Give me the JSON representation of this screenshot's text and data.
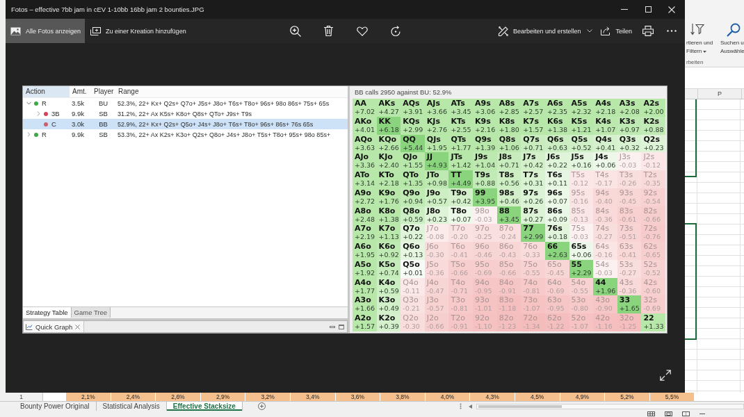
{
  "window": {
    "title": "Fotos – effective 7bb jam in cEV 1-10bb 16bb jam 2 bounties.JPG"
  },
  "toolbar": {
    "left": [
      {
        "label": "Alle Fotos anzeigen",
        "selected": true
      },
      {
        "label": "Zu einer Kreation hinzufügen",
        "selected": false
      }
    ],
    "right": [
      {
        "label": "Bearbeiten und erstellen",
        "kind": "menu"
      },
      {
        "label": "Teilen",
        "kind": "button"
      }
    ]
  },
  "image": {
    "strategy_table": {
      "columns": [
        {
          "label": "Action",
          "selected": true
        },
        {
          "label": "Amt.",
          "selected": false
        },
        {
          "label": "Player",
          "selected": false
        },
        {
          "label": "Range",
          "selected": false
        }
      ],
      "rows": [
        {
          "action": "R",
          "amount": "3.5k",
          "player": "BU",
          "range": "52.3%, 22+ Kx+ Q2s+ Q7o+ J5s+ J8o+ T6s+ T8o+ 96s+ 98o 86s+ 75s+ 65s",
          "color": "#3fa94a",
          "has_children": true,
          "expanded": true,
          "selected": false,
          "children": [
            {
              "action": "3B",
              "amount": "9.9k",
              "player": "SB",
              "range": "31.2%, 22+ Ax K5s+ K8o+ Q8s+ QTo+ J9s+ T9s",
              "color": "#d2455a",
              "has_children": true,
              "expanded": false,
              "selected": false
            },
            {
              "action": "C",
              "amount": "3.0k",
              "player": "BB",
              "range": "52.9%, 22+ Kx+ Q2s+ Q5o+ J4s+ J8o+ T6s+ T8o+ 96s+ 86s+ 76s 65s",
              "color": "#c9606f",
              "has_children": false,
              "selected": true
            }
          ]
        },
        {
          "action": "R",
          "amount": "9.9k",
          "player": "SB",
          "range": "53.3%, 22+ Ax K2s+ K3o+ Q2s+ Q8o+ J4s+ J8o+ T5s+ T8o+ 95s+ 98o 85s+",
          "color": "#3fa94a",
          "has_children": true,
          "expanded": false,
          "selected": false
        }
      ]
    },
    "view_tabs": [
      {
        "label": "Strategy Table",
        "selected": true
      },
      {
        "label": "Game Tree",
        "selected": false
      }
    ],
    "quick_graph": {
      "title": "Quick Graph"
    },
    "matrix": {
      "title": "BB calls 2950 against BU: 52.9%",
      "rows": [
        {
          "cells": [
            {
              "hand": "AA",
              "ev": "+7.02",
              "in_range": true,
              "highlighted": false
            },
            {
              "hand": "AKs",
              "ev": "+4.27",
              "in_range": true,
              "highlighted": false
            },
            {
              "hand": "AQs",
              "ev": "+3.91",
              "in_range": true,
              "highlighted": false
            },
            {
              "hand": "AJs",
              "ev": "+3.66",
              "in_range": true,
              "highlighted": false
            },
            {
              "hand": "ATs",
              "ev": "+3.45",
              "in_range": true,
              "highlighted": false
            },
            {
              "hand": "A9s",
              "ev": "+3.06",
              "in_range": true,
              "highlighted": false
            },
            {
              "hand": "A8s",
              "ev": "+2.85",
              "in_range": true,
              "highlighted": false
            },
            {
              "hand": "A7s",
              "ev": "+2.57",
              "in_range": true,
              "highlighted": false
            },
            {
              "hand": "A6s",
              "ev": "+2.35",
              "in_range": true,
              "highlighted": false
            },
            {
              "hand": "A5s",
              "ev": "+2.32",
              "in_range": true,
              "highlighted": false
            },
            {
              "hand": "A4s",
              "ev": "+2.18",
              "in_range": true,
              "highlighted": false
            },
            {
              "hand": "A3s",
              "ev": "+2.08",
              "in_range": true,
              "highlighted": false
            },
            {
              "hand": "A2s",
              "ev": "+2.00",
              "in_range": true,
              "highlighted": false
            }
          ]
        },
        {
          "cells": [
            {
              "hand": "AKo",
              "ev": "+4.01",
              "in_range": true,
              "highlighted": false
            },
            {
              "hand": "KK",
              "ev": "+6.18",
              "in_range": true,
              "highlighted": true
            },
            {
              "hand": "KQs",
              "ev": "+2.99",
              "in_range": true,
              "highlighted": false
            },
            {
              "hand": "KJs",
              "ev": "+2.76",
              "in_range": true,
              "highlighted": false
            },
            {
              "hand": "KTs",
              "ev": "+2.55",
              "in_range": true,
              "highlighted": false
            },
            {
              "hand": "K9s",
              "ev": "+2.16",
              "in_range": true,
              "highlighted": false
            },
            {
              "hand": "K8s",
              "ev": "+1.80",
              "in_range": true,
              "highlighted": false
            },
            {
              "hand": "K7s",
              "ev": "+1.57",
              "in_range": true,
              "highlighted": false
            },
            {
              "hand": "K6s",
              "ev": "+1.38",
              "in_range": true,
              "highlighted": false
            },
            {
              "hand": "K5s",
              "ev": "+1.21",
              "in_range": true,
              "highlighted": false
            },
            {
              "hand": "K4s",
              "ev": "+1.07",
              "in_range": true,
              "highlighted": false
            },
            {
              "hand": "K3s",
              "ev": "+0.97",
              "in_range": true,
              "highlighted": false
            },
            {
              "hand": "K2s",
              "ev": "+0.88",
              "in_range": true,
              "highlighted": false
            }
          ]
        },
        {
          "cells": [
            {
              "hand": "AQo",
              "ev": "+3.63",
              "in_range": true,
              "highlighted": false
            },
            {
              "hand": "KQo",
              "ev": "+2.66",
              "in_range": true,
              "highlighted": false
            },
            {
              "hand": "QQ",
              "ev": "+5.44",
              "in_range": true,
              "highlighted": true
            },
            {
              "hand": "QJs",
              "ev": "+1.95",
              "in_range": true,
              "highlighted": false
            },
            {
              "hand": "QTs",
              "ev": "+1.77",
              "in_range": true,
              "highlighted": false
            },
            {
              "hand": "Q9s",
              "ev": "+1.39",
              "in_range": true,
              "highlighted": false
            },
            {
              "hand": "Q8s",
              "ev": "+1.06",
              "in_range": true,
              "highlighted": false
            },
            {
              "hand": "Q7s",
              "ev": "+0.71",
              "in_range": true,
              "highlighted": false
            },
            {
              "hand": "Q6s",
              "ev": "+0.63",
              "in_range": true,
              "highlighted": false
            },
            {
              "hand": "Q5s",
              "ev": "+0.52",
              "in_range": true,
              "highlighted": false
            },
            {
              "hand": "Q4s",
              "ev": "+0.41",
              "in_range": true,
              "highlighted": false
            },
            {
              "hand": "Q3s",
              "ev": "+0.32",
              "in_range": true,
              "highlighted": false
            },
            {
              "hand": "Q2s",
              "ev": "+0.23",
              "in_range": true,
              "highlighted": false
            }
          ]
        },
        {
          "cells": [
            {
              "hand": "AJo",
              "ev": "+3.36",
              "in_range": true,
              "highlighted": false
            },
            {
              "hand": "KJo",
              "ev": "+2.40",
              "in_range": true,
              "highlighted": false
            },
            {
              "hand": "QJo",
              "ev": "+1.55",
              "in_range": true,
              "highlighted": false
            },
            {
              "hand": "JJ",
              "ev": "+4.93",
              "in_range": true,
              "highlighted": true
            },
            {
              "hand": "JTs",
              "ev": "+1.42",
              "in_range": true,
              "highlighted": false
            },
            {
              "hand": "J9s",
              "ev": "+1.04",
              "in_range": true,
              "highlighted": false
            },
            {
              "hand": "J8s",
              "ev": "+0.71",
              "in_range": true,
              "highlighted": false
            },
            {
              "hand": "J7s",
              "ev": "+0.42",
              "in_range": true,
              "highlighted": false
            },
            {
              "hand": "J6s",
              "ev": "+0.22",
              "in_range": true,
              "highlighted": false
            },
            {
              "hand": "J5s",
              "ev": "+0.16",
              "in_range": true,
              "highlighted": false
            },
            {
              "hand": "J4s",
              "ev": "+0.06",
              "in_range": true,
              "highlighted": false
            },
            {
              "hand": "J3s",
              "ev": "-0.03",
              "in_range": false,
              "highlighted": false
            },
            {
              "hand": "J2s",
              "ev": "-0.12",
              "in_range": false,
              "highlighted": false
            }
          ]
        },
        {
          "cells": [
            {
              "hand": "ATo",
              "ev": "+3.14",
              "in_range": true,
              "highlighted": false
            },
            {
              "hand": "KTo",
              "ev": "+2.18",
              "in_range": true,
              "highlighted": false
            },
            {
              "hand": "QTo",
              "ev": "+1.35",
              "in_range": true,
              "highlighted": false
            },
            {
              "hand": "JTo",
              "ev": "+0.98",
              "in_range": true,
              "highlighted": false
            },
            {
              "hand": "TT",
              "ev": "+4.49",
              "in_range": true,
              "highlighted": true
            },
            {
              "hand": "T9s",
              "ev": "+0.88",
              "in_range": true,
              "highlighted": false
            },
            {
              "hand": "T8s",
              "ev": "+0.56",
              "in_range": true,
              "highlighted": false
            },
            {
              "hand": "T7s",
              "ev": "+0.31",
              "in_range": true,
              "highlighted": false
            },
            {
              "hand": "T6s",
              "ev": "+0.11",
              "in_range": true,
              "highlighted": false
            },
            {
              "hand": "T5s",
              "ev": "-0.12",
              "in_range": false,
              "highlighted": false
            },
            {
              "hand": "T4s",
              "ev": "-0.17",
              "in_range": false,
              "highlighted": false
            },
            {
              "hand": "T3s",
              "ev": "-0.26",
              "in_range": false,
              "highlighted": false
            },
            {
              "hand": "T2s",
              "ev": "-0.35",
              "in_range": false,
              "highlighted": false
            }
          ]
        },
        {
          "cells": [
            {
              "hand": "A9o",
              "ev": "+2.72",
              "in_range": true,
              "highlighted": false
            },
            {
              "hand": "K9o",
              "ev": "+1.76",
              "in_range": true,
              "highlighted": false
            },
            {
              "hand": "Q9o",
              "ev": "+0.94",
              "in_range": true,
              "highlighted": false
            },
            {
              "hand": "J9o",
              "ev": "+0.57",
              "in_range": true,
              "highlighted": false
            },
            {
              "hand": "T9o",
              "ev": "+0.42",
              "in_range": true,
              "highlighted": false
            },
            {
              "hand": "99",
              "ev": "+3.95",
              "in_range": true,
              "highlighted": true
            },
            {
              "hand": "98s",
              "ev": "+0.46",
              "in_range": true,
              "highlighted": false
            },
            {
              "hand": "97s",
              "ev": "+0.26",
              "in_range": true,
              "highlighted": false
            },
            {
              "hand": "96s",
              "ev": "+0.07",
              "in_range": true,
              "highlighted": false
            },
            {
              "hand": "95s",
              "ev": "-0.16",
              "in_range": false,
              "highlighted": false
            },
            {
              "hand": "94s",
              "ev": "-0.40",
              "in_range": false,
              "highlighted": false
            },
            {
              "hand": "93s",
              "ev": "-0.45",
              "in_range": false,
              "highlighted": false
            },
            {
              "hand": "92s",
              "ev": "-0.54",
              "in_range": false,
              "highlighted": false
            }
          ]
        },
        {
          "cells": [
            {
              "hand": "A8o",
              "ev": "+2.48",
              "in_range": true,
              "highlighted": false
            },
            {
              "hand": "K8o",
              "ev": "+1.38",
              "in_range": true,
              "highlighted": false
            },
            {
              "hand": "Q8o",
              "ev": "+0.59",
              "in_range": true,
              "highlighted": false
            },
            {
              "hand": "J8o",
              "ev": "+0.23",
              "in_range": true,
              "highlighted": false
            },
            {
              "hand": "T8o",
              "ev": "+0.07",
              "in_range": true,
              "highlighted": false
            },
            {
              "hand": "98o",
              "ev": "-0.03",
              "in_range": false,
              "highlighted": false
            },
            {
              "hand": "88",
              "ev": "+3.45",
              "in_range": true,
              "highlighted": true
            },
            {
              "hand": "87s",
              "ev": "+0.27",
              "in_range": true,
              "highlighted": false
            },
            {
              "hand": "86s",
              "ev": "+0.09",
              "in_range": true,
              "highlighted": false
            },
            {
              "hand": "85s",
              "ev": "-0.13",
              "in_range": false,
              "highlighted": false
            },
            {
              "hand": "84s",
              "ev": "-0.36",
              "in_range": false,
              "highlighted": false
            },
            {
              "hand": "83s",
              "ev": "-0.61",
              "in_range": false,
              "highlighted": false
            },
            {
              "hand": "82s",
              "ev": "-0.66",
              "in_range": false,
              "highlighted": false
            }
          ]
        },
        {
          "cells": [
            {
              "hand": "A7o",
              "ev": "+2.19",
              "in_range": true,
              "highlighted": false
            },
            {
              "hand": "K7o",
              "ev": "+1.13",
              "in_range": true,
              "highlighted": false
            },
            {
              "hand": "Q7o",
              "ev": "+0.22",
              "in_range": true,
              "highlighted": false
            },
            {
              "hand": "J7o",
              "ev": "-0.08",
              "in_range": false,
              "highlighted": false
            },
            {
              "hand": "T7o",
              "ev": "-0.20",
              "in_range": false,
              "highlighted": false
            },
            {
              "hand": "97o",
              "ev": "-0.25",
              "in_range": false,
              "highlighted": false
            },
            {
              "hand": "87o",
              "ev": "-0.24",
              "in_range": false,
              "highlighted": false
            },
            {
              "hand": "77",
              "ev": "+2.99",
              "in_range": true,
              "highlighted": true
            },
            {
              "hand": "76s",
              "ev": "+0.18",
              "in_range": true,
              "highlighted": false
            },
            {
              "hand": "75s",
              "ev": "-0.03",
              "in_range": false,
              "highlighted": false
            },
            {
              "hand": "74s",
              "ev": "-0.27",
              "in_range": false,
              "highlighted": false
            },
            {
              "hand": "73s",
              "ev": "-0.51",
              "in_range": false,
              "highlighted": false
            },
            {
              "hand": "72s",
              "ev": "-0.76",
              "in_range": false,
              "highlighted": false
            }
          ]
        },
        {
          "cells": [
            {
              "hand": "A6o",
              "ev": "+1.95",
              "in_range": true,
              "highlighted": false
            },
            {
              "hand": "K6o",
              "ev": "+0.92",
              "in_range": true,
              "highlighted": false
            },
            {
              "hand": "Q6o",
              "ev": "+0.13",
              "in_range": true,
              "highlighted": false
            },
            {
              "hand": "J6o",
              "ev": "-0.30",
              "in_range": false,
              "highlighted": false
            },
            {
              "hand": "T6o",
              "ev": "-0.41",
              "in_range": false,
              "highlighted": false
            },
            {
              "hand": "96o",
              "ev": "-0.46",
              "in_range": false,
              "highlighted": false
            },
            {
              "hand": "86o",
              "ev": "-0.43",
              "in_range": false,
              "highlighted": false
            },
            {
              "hand": "76o",
              "ev": "-0.33",
              "in_range": false,
              "highlighted": false
            },
            {
              "hand": "66",
              "ev": "+2.63",
              "in_range": true,
              "highlighted": true
            },
            {
              "hand": "65s",
              "ev": "+0.06",
              "in_range": true,
              "highlighted": false
            },
            {
              "hand": "64s",
              "ev": "-0.16",
              "in_range": false,
              "highlighted": false
            },
            {
              "hand": "63s",
              "ev": "-0.41",
              "in_range": false,
              "highlighted": false
            },
            {
              "hand": "62s",
              "ev": "-0.65",
              "in_range": false,
              "highlighted": false
            }
          ]
        },
        {
          "cells": [
            {
              "hand": "A5o",
              "ev": "+1.92",
              "in_range": true,
              "highlighted": false
            },
            {
              "hand": "K5o",
              "ev": "+0.74",
              "in_range": true,
              "highlighted": false
            },
            {
              "hand": "Q5o",
              "ev": "+0.01",
              "in_range": true,
              "highlighted": false
            },
            {
              "hand": "J5o",
              "ev": "-0.36",
              "in_range": false,
              "highlighted": false
            },
            {
              "hand": "T5o",
              "ev": "-0.66",
              "in_range": false,
              "highlighted": false
            },
            {
              "hand": "95o",
              "ev": "-0.69",
              "in_range": false,
              "highlighted": false
            },
            {
              "hand": "85o",
              "ev": "-0.66",
              "in_range": false,
              "highlighted": false
            },
            {
              "hand": "75o",
              "ev": "-0.55",
              "in_range": false,
              "highlighted": false
            },
            {
              "hand": "65o",
              "ev": "-0.45",
              "in_range": false,
              "highlighted": false
            },
            {
              "hand": "55",
              "ev": "+2.29",
              "in_range": true,
              "highlighted": true
            },
            {
              "hand": "54s",
              "ev": "-0.03",
              "in_range": false,
              "highlighted": false
            },
            {
              "hand": "53s",
              "ev": "-0.27",
              "in_range": false,
              "highlighted": false
            },
            {
              "hand": "52s",
              "ev": "-0.52",
              "in_range": false,
              "highlighted": false
            }
          ]
        },
        {
          "cells": [
            {
              "hand": "A4o",
              "ev": "+1.77",
              "in_range": true,
              "highlighted": false
            },
            {
              "hand": "K4o",
              "ev": "+0.59",
              "in_range": true,
              "highlighted": false
            },
            {
              "hand": "Q4o",
              "ev": "-0.11",
              "in_range": false,
              "highlighted": false
            },
            {
              "hand": "J4o",
              "ev": "-0.47",
              "in_range": false,
              "highlighted": false
            },
            {
              "hand": "T4o",
              "ev": "-0.71",
              "in_range": false,
              "highlighted": false
            },
            {
              "hand": "94o",
              "ev": "-0.95",
              "in_range": false,
              "highlighted": false
            },
            {
              "hand": "84o",
              "ev": "-0.91",
              "in_range": false,
              "highlighted": false
            },
            {
              "hand": "74o",
              "ev": "-0.81",
              "in_range": false,
              "highlighted": false
            },
            {
              "hand": "64o",
              "ev": "-0.69",
              "in_range": false,
              "highlighted": false
            },
            {
              "hand": "54o",
              "ev": "-0.55",
              "in_range": false,
              "highlighted": false
            },
            {
              "hand": "44",
              "ev": "+1.96",
              "in_range": true,
              "highlighted": true
            },
            {
              "hand": "43s",
              "ev": "-0.36",
              "in_range": false,
              "highlighted": false
            },
            {
              "hand": "42s",
              "ev": "-0.60",
              "in_range": false,
              "highlighted": false
            }
          ]
        },
        {
          "cells": [
            {
              "hand": "A3o",
              "ev": "+1.66",
              "in_range": true,
              "highlighted": false
            },
            {
              "hand": "K3o",
              "ev": "+0.49",
              "in_range": true,
              "highlighted": false
            },
            {
              "hand": "Q3o",
              "ev": "-0.21",
              "in_range": false,
              "highlighted": false
            },
            {
              "hand": "J3o",
              "ev": "-0.57",
              "in_range": false,
              "highlighted": false
            },
            {
              "hand": "T3o",
              "ev": "-0.81",
              "in_range": false,
              "highlighted": false
            },
            {
              "hand": "93o",
              "ev": "-1.01",
              "in_range": false,
              "highlighted": false
            },
            {
              "hand": "83o",
              "ev": "-1.18",
              "in_range": false,
              "highlighted": false
            },
            {
              "hand": "73o",
              "ev": "-1.07",
              "in_range": false,
              "highlighted": false
            },
            {
              "hand": "63o",
              "ev": "-0.95",
              "in_range": false,
              "highlighted": false
            },
            {
              "hand": "53o",
              "ev": "-0.80",
              "in_range": false,
              "highlighted": false
            },
            {
              "hand": "43o",
              "ev": "-0.90",
              "in_range": false,
              "highlighted": false
            },
            {
              "hand": "33",
              "ev": "+1.65",
              "in_range": true,
              "highlighted": true
            },
            {
              "hand": "32s",
              "ev": "-0.69",
              "in_range": false,
              "highlighted": false
            }
          ]
        },
        {
          "cells": [
            {
              "hand": "A2o",
              "ev": "+1.57",
              "in_range": true,
              "highlighted": false
            },
            {
              "hand": "K2o",
              "ev": "+0.39",
              "in_range": true,
              "highlighted": false
            },
            {
              "hand": "Q2o",
              "ev": "-0.30",
              "in_range": false,
              "highlighted": false
            },
            {
              "hand": "J2o",
              "ev": "-0.66",
              "in_range": false,
              "highlighted": false
            },
            {
              "hand": "T2o",
              "ev": "-0.91",
              "in_range": false,
              "highlighted": false
            },
            {
              "hand": "92o",
              "ev": "-1.10",
              "in_range": false,
              "highlighted": false
            },
            {
              "hand": "82o",
              "ev": "-1.23",
              "in_range": false,
              "highlighted": false
            },
            {
              "hand": "72o",
              "ev": "-1.34",
              "in_range": false,
              "highlighted": false
            },
            {
              "hand": "62o",
              "ev": "-1.22",
              "in_range": false,
              "highlighted": false
            },
            {
              "hand": "52o",
              "ev": "-1.07",
              "in_range": false,
              "highlighted": false
            },
            {
              "hand": "42o",
              "ev": "-1.16",
              "in_range": false,
              "highlighted": false
            },
            {
              "hand": "32o",
              "ev": "-1.25",
              "in_range": false,
              "highlighted": false
            },
            {
              "hand": "22",
              "ev": "+1.33",
              "in_range": true,
              "highlighted": false
            }
          ]
        }
      ]
    }
  },
  "excel": {
    "ribbon": {
      "buttons": [
        {
          "lines": [
            "rtieren und",
            "Filtern"
          ],
          "dropdown": true
        },
        {
          "lines": [
            "Suchen u",
            "Auswähle"
          ]
        }
      ],
      "group_label": "rbeiten"
    },
    "column_header": "P",
    "row_number": "1",
    "row_values": [
      "2,1%",
      "2,4%",
      "2,6%",
      "2,9%",
      "3,2%",
      "3,4%",
      "3,6%",
      "3,8%",
      "4,0%",
      "4,3%",
      "4,5%",
      "4,9%",
      "5,2%",
      "5,5%"
    ],
    "sheet_tabs": [
      {
        "label": "Bounty Power Original",
        "selected": false
      },
      {
        "label": "Statistical Analysis",
        "selected": false
      },
      {
        "label": "Effective Stacksize",
        "selected": true
      }
    ]
  }
}
